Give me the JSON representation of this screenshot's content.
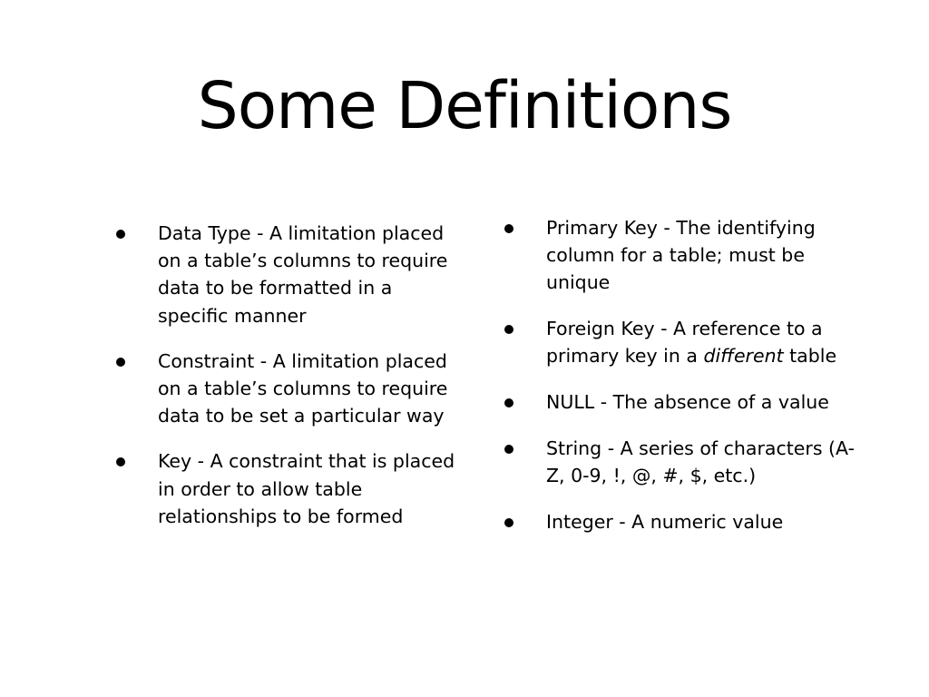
{
  "slide": {
    "title": "Some Definitions",
    "left_column": [
      {
        "text": "Data Type - A limitation placed on a table’s columns to require data to be formatted in a specific manner"
      },
      {
        "text": "Constraint - A limitation placed on a table’s columns to require data to be set a particular way"
      },
      {
        "text": "Key - A constraint that is placed in order to allow table relationships to be formed"
      }
    ],
    "right_column": [
      {
        "text": "Primary Key - The identifying column for a table; must be unique"
      },
      {
        "text_before": "Foreign Key - A reference to a primary key in a ",
        "emphasis": "different",
        "text_after": " table"
      },
      {
        "text": "NULL - The absence of a value"
      },
      {
        "text": "String - A series of characters (A-Z, 0-9, !, @, #, $, etc.)"
      },
      {
        "text": "Integer - A numeric value"
      }
    ]
  },
  "colors": {
    "background": "#ffffff",
    "text": "#000000"
  }
}
